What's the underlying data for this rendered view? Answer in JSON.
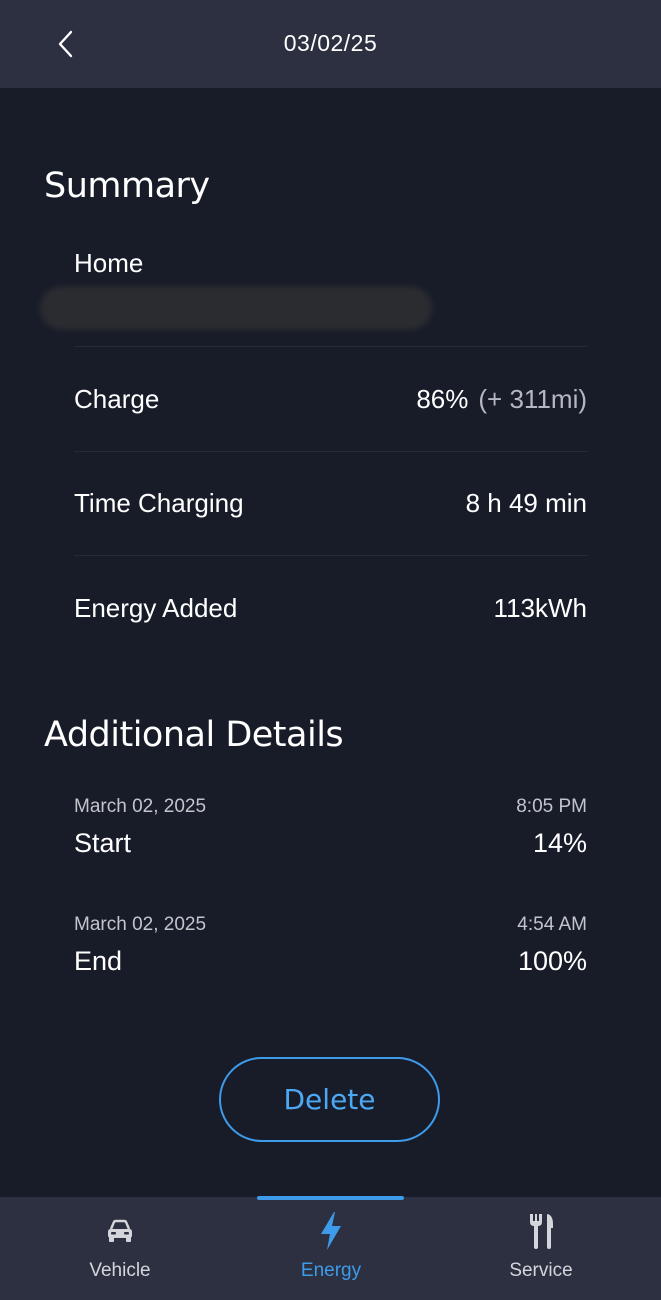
{
  "header": {
    "title": "03/02/25"
  },
  "summary": {
    "title": "Summary",
    "location": "Home",
    "rows": [
      {
        "label": "Charge",
        "value": "86%",
        "extra": "(+ 311mi)"
      },
      {
        "label": "Time Charging",
        "value": "8 h 49 min"
      },
      {
        "label": "Energy Added",
        "value": "113kWh"
      }
    ]
  },
  "details": {
    "title": "Additional Details",
    "entries": [
      {
        "date": "March 02, 2025",
        "time": "8:05 PM",
        "label": "Start",
        "value": "14%"
      },
      {
        "date": "March 02, 2025",
        "time": "4:54 AM",
        "label": "End",
        "value": "100%"
      }
    ]
  },
  "actions": {
    "delete_label": "Delete"
  },
  "nav": {
    "items": [
      {
        "label": "Vehicle",
        "icon": "car-icon",
        "active": false
      },
      {
        "label": "Energy",
        "icon": "lightning-bolt-icon",
        "active": true
      },
      {
        "label": "Service",
        "icon": "tools-icon",
        "active": false
      }
    ]
  },
  "colors": {
    "background": "#181c29",
    "header": "#2c3040",
    "accent": "#3d9be9"
  }
}
